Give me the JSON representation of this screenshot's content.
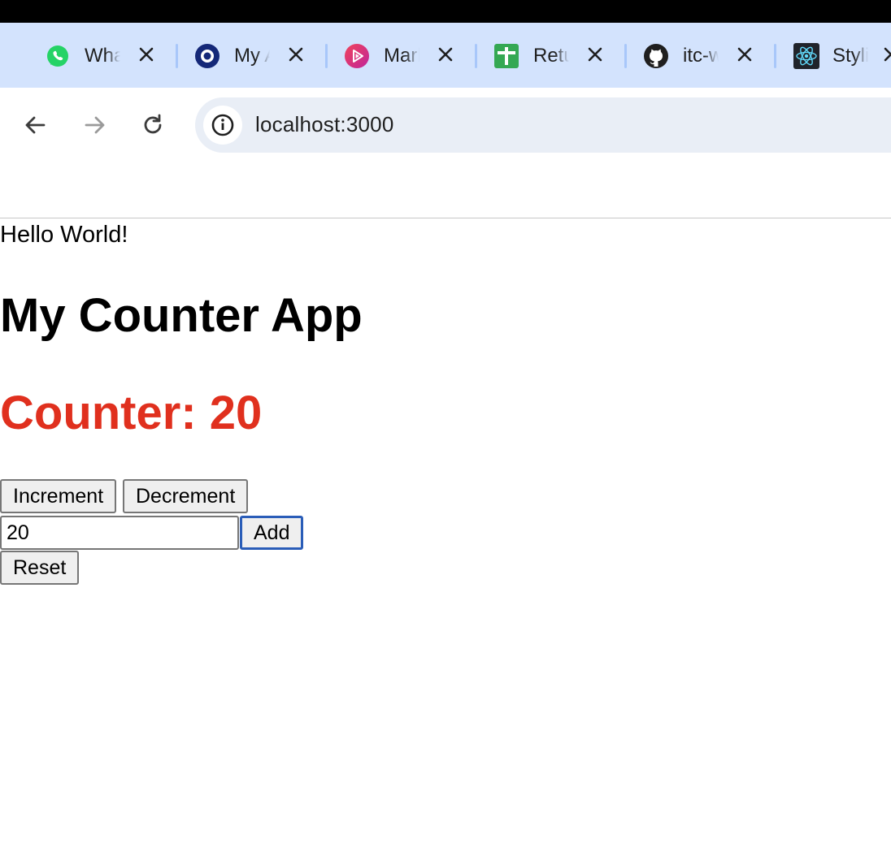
{
  "browser": {
    "tabs": [
      {
        "title": "WhatsApp",
        "icon": "whatsapp-icon"
      },
      {
        "title": "My Account",
        "icon": "ring-logo-icon"
      },
      {
        "title": "Markdown",
        "icon": "play-video-icon"
      },
      {
        "title": "Return",
        "icon": "spreadsheet-plus-icon"
      },
      {
        "title": "itc-web",
        "icon": "github-icon"
      },
      {
        "title": "Styling",
        "icon": "react-icon"
      }
    ],
    "address": "localhost:3000"
  },
  "app": {
    "hello": "Hello World!",
    "title": "My Counter App",
    "counter_label": "Counter: 20",
    "increment_label": "Increment",
    "decrement_label": "Decrement",
    "input_value": "20",
    "add_label": "Add",
    "reset_label": "Reset"
  },
  "colors": {
    "counter": "#e0301e",
    "tabstrip": "#d3e3fd",
    "omnibox": "#e9eef6",
    "focus_ring": "#2a5db8"
  }
}
